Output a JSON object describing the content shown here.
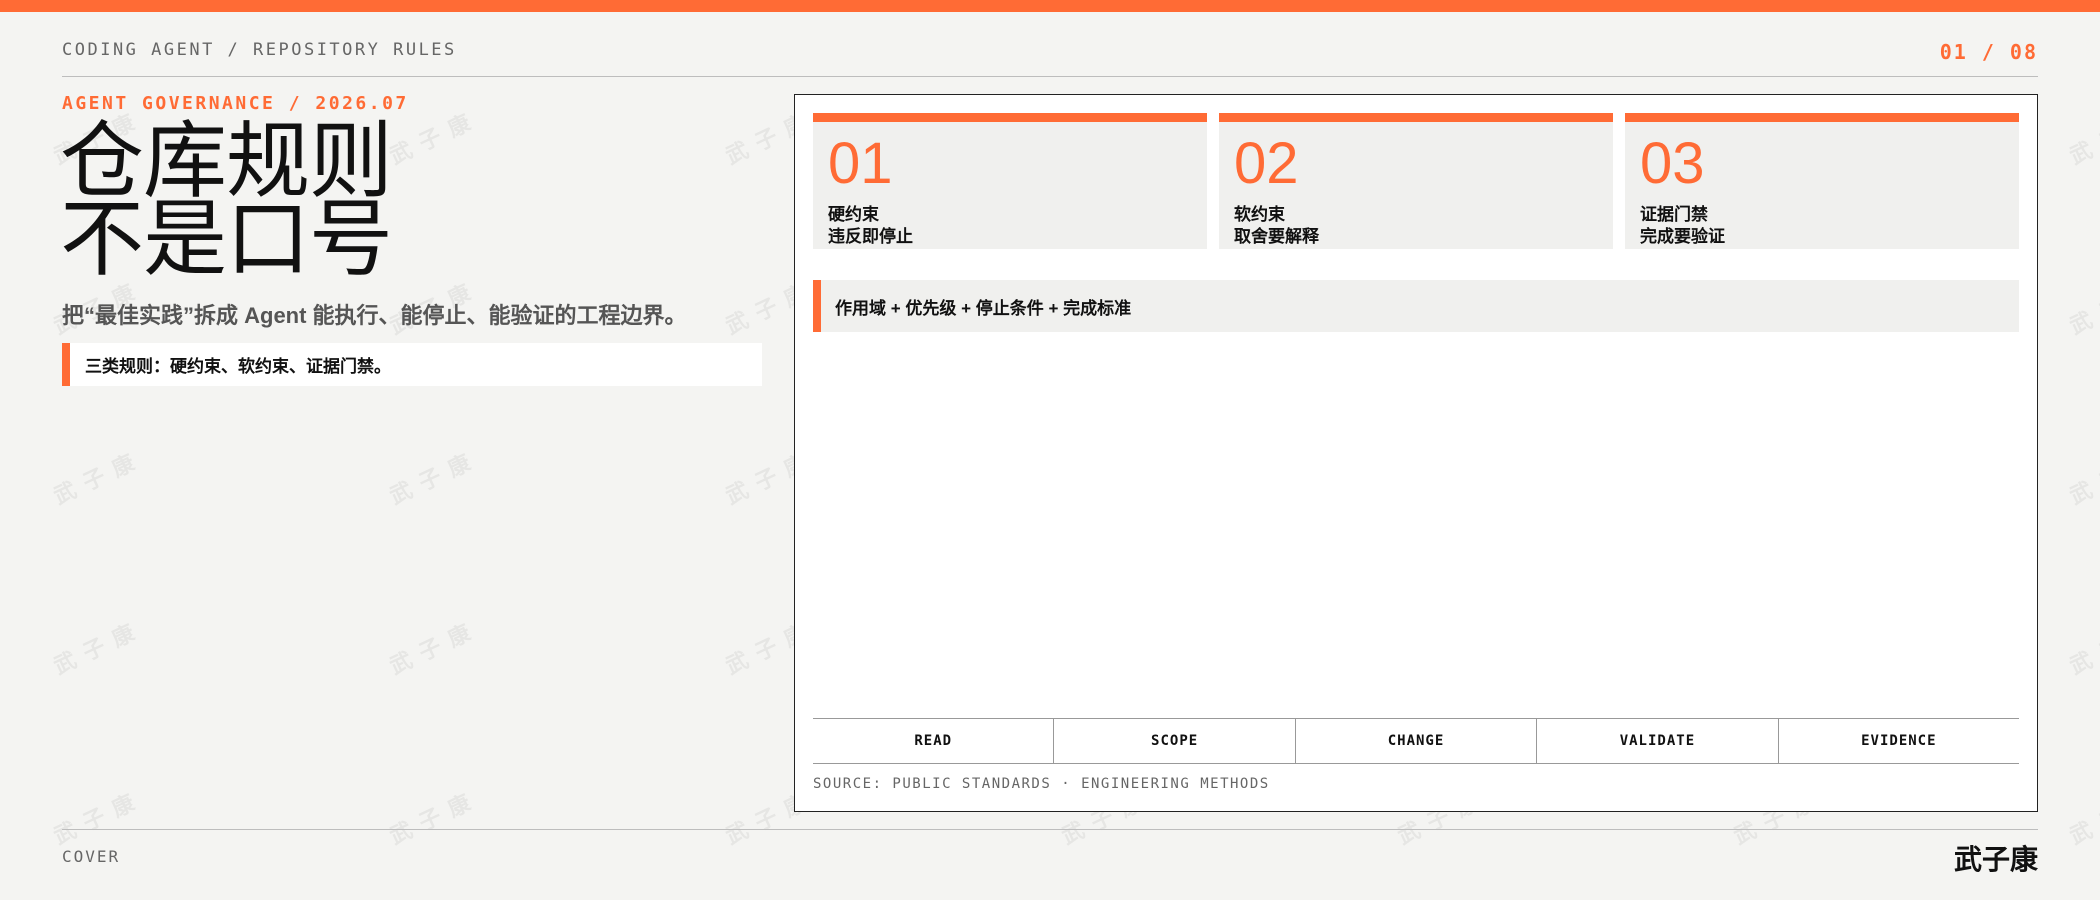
{
  "header": {
    "breadcrumb": "CODING AGENT / REPOSITORY RULES",
    "page_indicator": "01 / 08"
  },
  "left": {
    "eyebrow": "AGENT GOVERNANCE / 2026.07",
    "title_lines": [
      "仓库规则",
      "不是口号"
    ],
    "subtitle": "把“最佳实践”拆成 Agent 能执行、能停止、能验证的工程边界。",
    "callout": "三类规则：硬约束、软约束、证据门禁。"
  },
  "panel": {
    "cards": [
      {
        "number": "01",
        "line1": "硬约束",
        "line2": "违反即停止"
      },
      {
        "number": "02",
        "line1": "软约束",
        "line2": "取舍要解释"
      },
      {
        "number": "03",
        "line1": "证据门禁",
        "line2": "完成要验证"
      }
    ],
    "formula": "作用域 + 优先级 + 停止条件 + 完成标准",
    "steps": [
      "READ",
      "SCOPE",
      "CHANGE",
      "VALIDATE",
      "EVIDENCE"
    ],
    "source": "SOURCE: PUBLIC STANDARDS · ENGINEERING METHODS"
  },
  "footer": {
    "section": "COVER",
    "author": "武子康"
  },
  "watermark": "武子康",
  "colors": {
    "accent": "#ff6b35",
    "background": "#f4f4f2",
    "panel": "#ffffff",
    "card": "#f0f0ee"
  }
}
